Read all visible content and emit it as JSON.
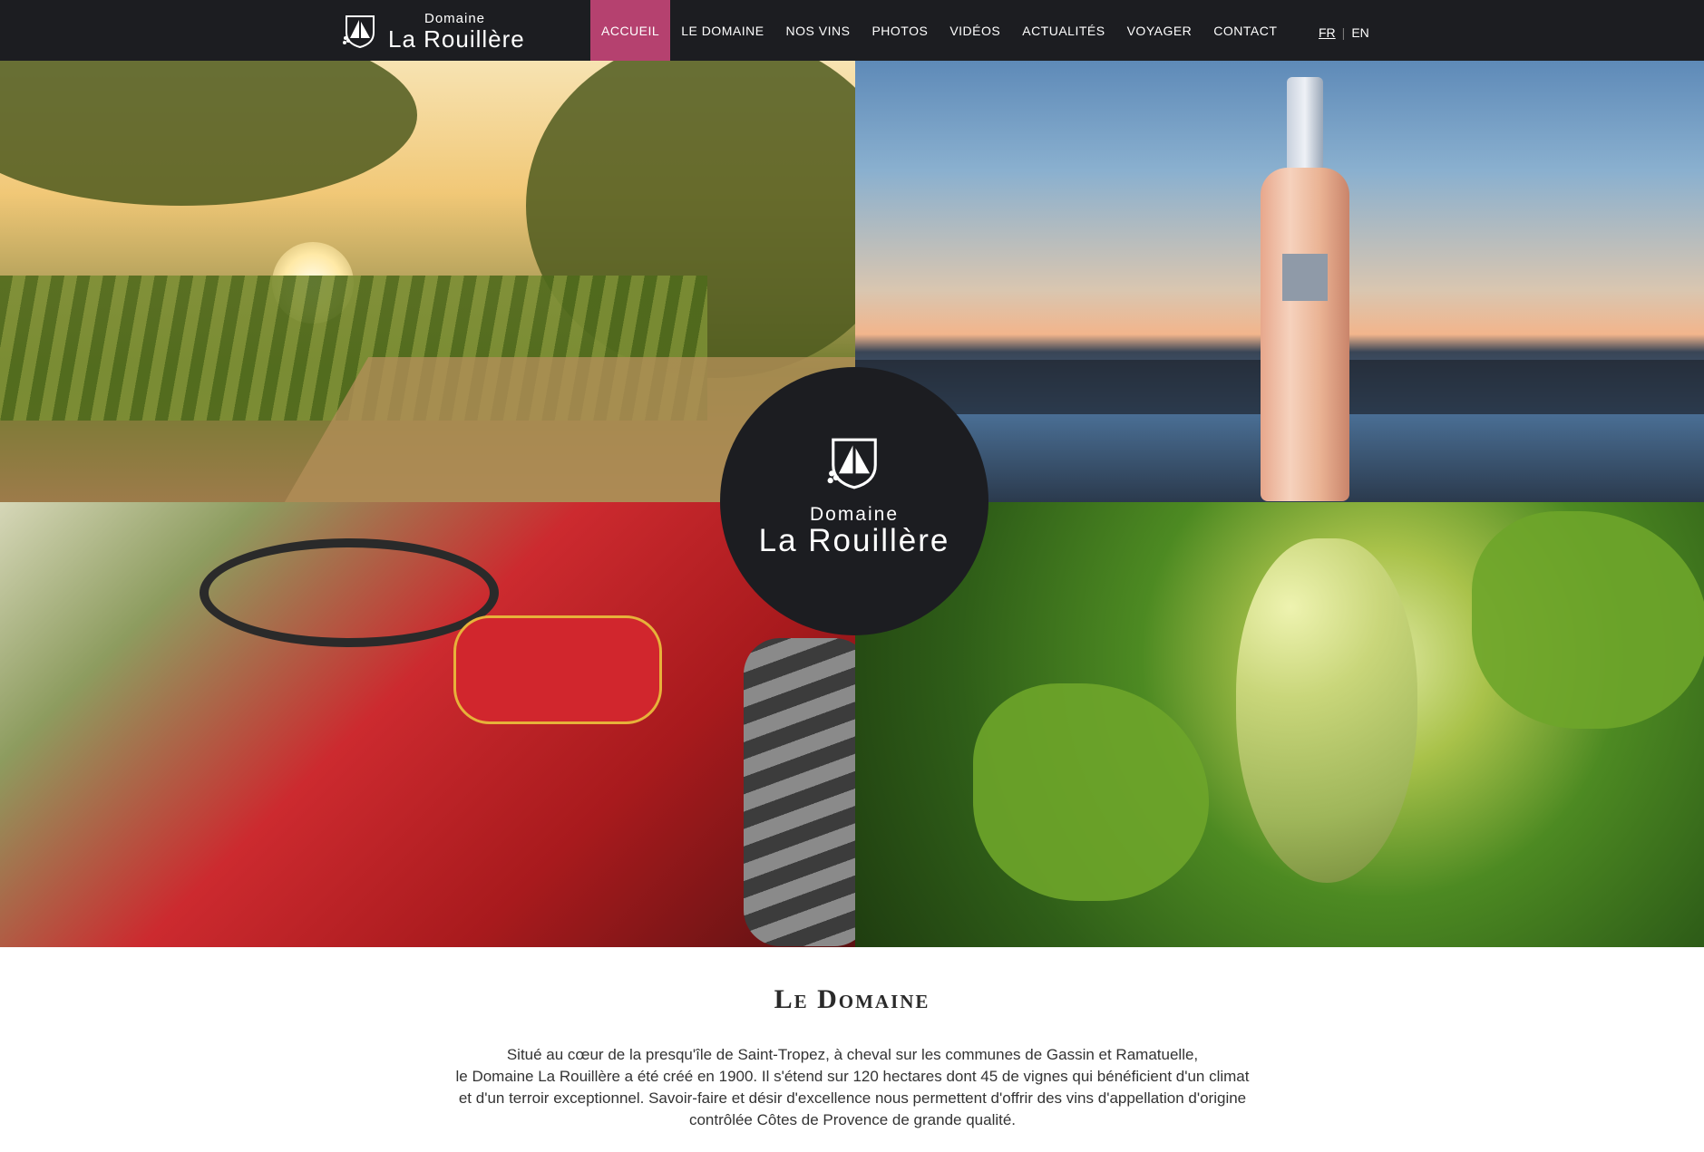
{
  "brand": {
    "small": "Domaine",
    "big": "La Rouillère"
  },
  "nav": {
    "items": [
      {
        "label": "Accueil",
        "active": true
      },
      {
        "label": "Le Domaine",
        "active": false
      },
      {
        "label": "Nos vins",
        "active": false
      },
      {
        "label": "Photos",
        "active": false
      },
      {
        "label": "Vidéos",
        "active": false
      },
      {
        "label": "Actualités",
        "active": false
      },
      {
        "label": "Voyager",
        "active": false
      },
      {
        "label": "Contact",
        "active": false
      }
    ],
    "active_color": "#b5416f"
  },
  "lang": {
    "fr": "FR",
    "separator": "|",
    "en": "EN"
  },
  "center_logo": {
    "small": "Domaine",
    "big": "La Rouillère"
  },
  "photos": [
    {
      "name": "vineyard-sunrise"
    },
    {
      "name": "rose-bottle-sunset"
    },
    {
      "name": "red-tractor"
    },
    {
      "name": "white-grapes"
    }
  ],
  "section": {
    "title": "Le Domaine",
    "lines": [
      "Situé au cœur de la presqu'île de Saint-Tropez, à cheval sur les communes de Gassin et Ramatuelle,",
      "le Domaine La Rouillère a été créé en 1900. Il s'étend sur 120 hectares dont 45 de vignes qui bénéficient d'un climat",
      "et d'un terroir exceptionnel. Savoir-faire et désir d'excellence nous permettent d'offrir des vins d'appellation d'origine",
      "contrôlée Côtes de Provence de grande qualité."
    ]
  },
  "colors": {
    "header_bg": "#1c1d21",
    "accent": "#b5416f"
  }
}
